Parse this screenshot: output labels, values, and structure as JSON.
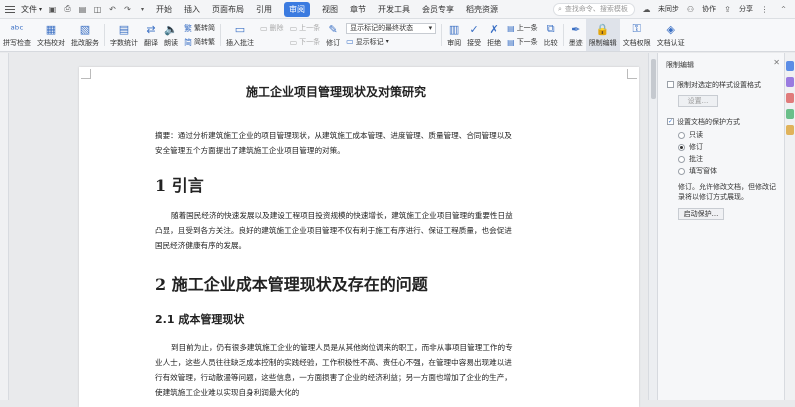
{
  "menubar": {
    "file": "文件",
    "tabs": [
      "开始",
      "插入",
      "页面布局",
      "引用",
      "审阅",
      "视图",
      "章节",
      "开发工具",
      "会员专享",
      "稻壳资源"
    ],
    "active_tab": "审阅",
    "search_placeholder": "查找命令、搜索模板",
    "unsynced": "未同步",
    "collab": "协作",
    "share": "分享"
  },
  "ribbon": {
    "spellcheck": "拼写检查",
    "doc_proof": "文档校对",
    "batch_service": "批改服务",
    "word_count": "字数统计",
    "translate": "翻译",
    "read_aloud": "朗读",
    "trad_simp": "繁转简",
    "simp_trad": "简转繁",
    "insert_comment": "插入批注",
    "delete": "删除",
    "prev": "上一条",
    "next": "下一条",
    "revise": "修订",
    "display_state": "显示标记的最终状态",
    "show_markup": "显示标记",
    "review": "审阅",
    "accept": "接受",
    "reject": "拒绝",
    "prev2": "上一条",
    "next2": "下一条",
    "compare": "比较",
    "ink": "墨迹",
    "restrict_edit": "限制编辑",
    "doc_perm": "文档权限",
    "doc_cert": "文档认证"
  },
  "document": {
    "title": "施工企业项目管理现状及对策研究",
    "abstract": "摘要：通过分析建筑施工企业的项目管理现状，从建筑施工成本管理、进度管理、质量管理、合同管理以及安全管理五个方面提出了建筑施工企业项目管理的对策。",
    "h1_1": "1 引言",
    "intro": "随着国民经济的快速发展以及建设工程项目投资规模的快速增长，建筑施工企业项目管理的重要性日益凸显，且受到各方关注。良好的建筑施工企业项目管理不仅有利于施工有序进行、保证工程质量，也会促进国民经济健康有序的发展。",
    "h1_2": "2 施工企业成本管理现状及存在的问题",
    "h2_1": "2.1 成本管理现状",
    "para2": "到目前为止，仍有很多建筑施工企业的管理人员是从其他岗位调来的职工，而非从事项目管理工作的专业人士，这些人员往往缺乏成本控制的实践经验，工作积极性不高、责任心不强，在管理中容易出现难以进行有效管理，行动散漫等问题，这些信息，一方面损害了企业的经济利益；另一方面也增加了企业的生产，使建筑施工企业难以实现自身利润最大化的"
  },
  "panel": {
    "title": "限制编辑",
    "opt1": "限制对选定的样式设置格式",
    "settings_btn": "设置...",
    "opt2": "设置文档的保护方式",
    "radios": [
      "只读",
      "修订",
      "批注",
      "填写窗体"
    ],
    "selected_radio": "修订",
    "desc": "修订。允许修改文档，但修改记录将以修订方式展现。",
    "start_btn": "启动保护..."
  }
}
